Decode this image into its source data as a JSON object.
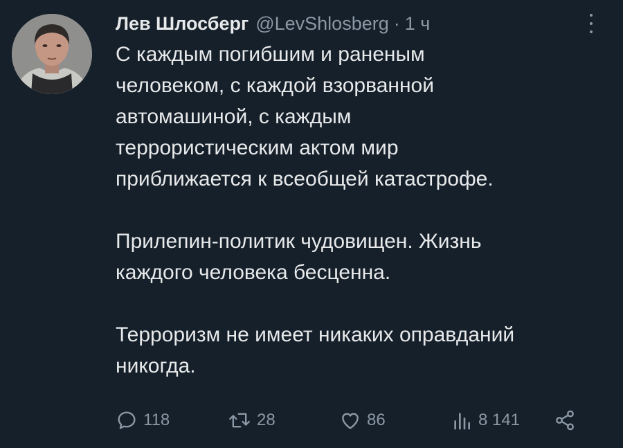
{
  "author": {
    "name": "Лев Шлосберг",
    "handle": "@LevShlosberg",
    "separator": "·",
    "time": "1 ч"
  },
  "tweet": {
    "paragraphs": [
      [
        "С каждым погибшим и раненым",
        "человеком, с каждой взорванной",
        "автомашиной, с каждым",
        "террористическим актом мир",
        "приближается к всеобщей катастрофе."
      ],
      [
        "Прилепин-политик чудовищен. Жизнь",
        "каждого человека бесценна."
      ],
      [
        "Терроризм не имеет никаких оправданий",
        "никогда."
      ]
    ]
  },
  "actions": {
    "replies": "118",
    "retweets": "28",
    "likes": "86",
    "views": "8 141"
  },
  "icons": {
    "avatar": "avatar-photo",
    "more": "more-vertical-icon",
    "reply": "reply-icon",
    "retweet": "retweet-icon",
    "like": "heart-icon",
    "views": "views-bar-icon",
    "share": "share-icon"
  },
  "colors": {
    "background": "#16202a",
    "text": "#e7e9ea",
    "secondary": "#8b98a5"
  }
}
